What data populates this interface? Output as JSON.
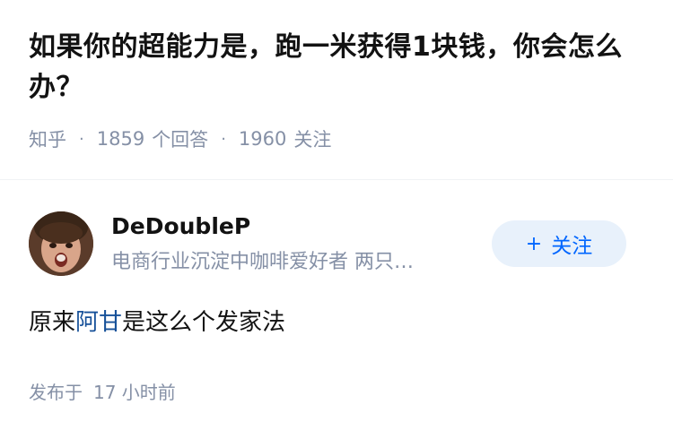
{
  "question": {
    "title": "如果你的超能力是，跑一米获得1块钱，你会怎么办？",
    "source": "知乎",
    "answer_count": "1859",
    "answer_label": "个回答",
    "follower_count": "1960",
    "follower_label": "关注"
  },
  "answer": {
    "author": {
      "name": "DeDoubleP",
      "bio": "电商行业沉淀中咖啡爱好者 两只…",
      "avatar": "avatar"
    },
    "follow_button": {
      "plus": "+",
      "label": "关注"
    },
    "content": {
      "before": "原来",
      "link": "阿甘",
      "after": "是这么个发家法"
    },
    "published_label": "发布于",
    "published_time": "17 小时前"
  },
  "colors": {
    "text": "#121212",
    "meta": "#8590a6",
    "link": "#175199",
    "accent": "#0066ff",
    "follow_bg": "#e8f1fb"
  }
}
